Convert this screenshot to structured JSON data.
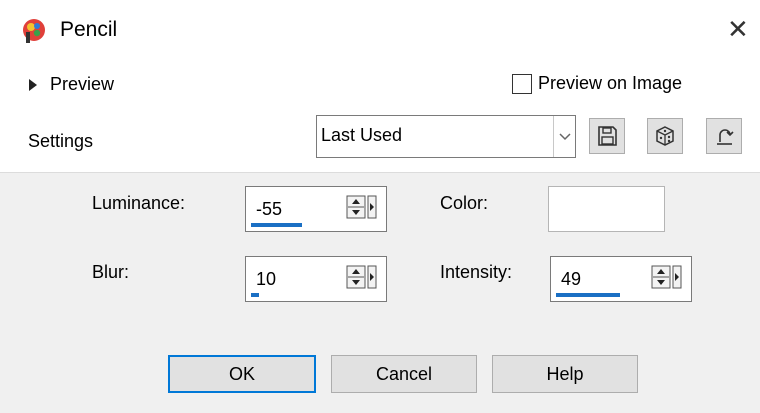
{
  "window": {
    "title": "Pencil",
    "close_glyph": "✕"
  },
  "preview": {
    "label": "Preview",
    "on_image_label": "Preview on Image",
    "on_image_checked": false
  },
  "settings": {
    "label": "Settings",
    "preset_value": "Last Used",
    "icons": [
      "save-preset-icon",
      "randomize-icon",
      "reset-icon"
    ]
  },
  "params": {
    "luminance": {
      "label": "Luminance:",
      "value": "-55",
      "slider_fraction": 0.39
    },
    "blur": {
      "label": "Blur:",
      "value": "10",
      "slider_fraction": 0.06
    },
    "color": {
      "label": "Color:",
      "value": "#ffffff"
    },
    "intensity": {
      "label": "Intensity:",
      "value": "49",
      "slider_fraction": 0.49
    }
  },
  "buttons": {
    "ok": "OK",
    "cancel": "Cancel",
    "help": "Help"
  },
  "colors": {
    "accent": "#0078d7",
    "slider_fill": "#1a6fc4",
    "panel_bg": "#f0f0f0"
  }
}
